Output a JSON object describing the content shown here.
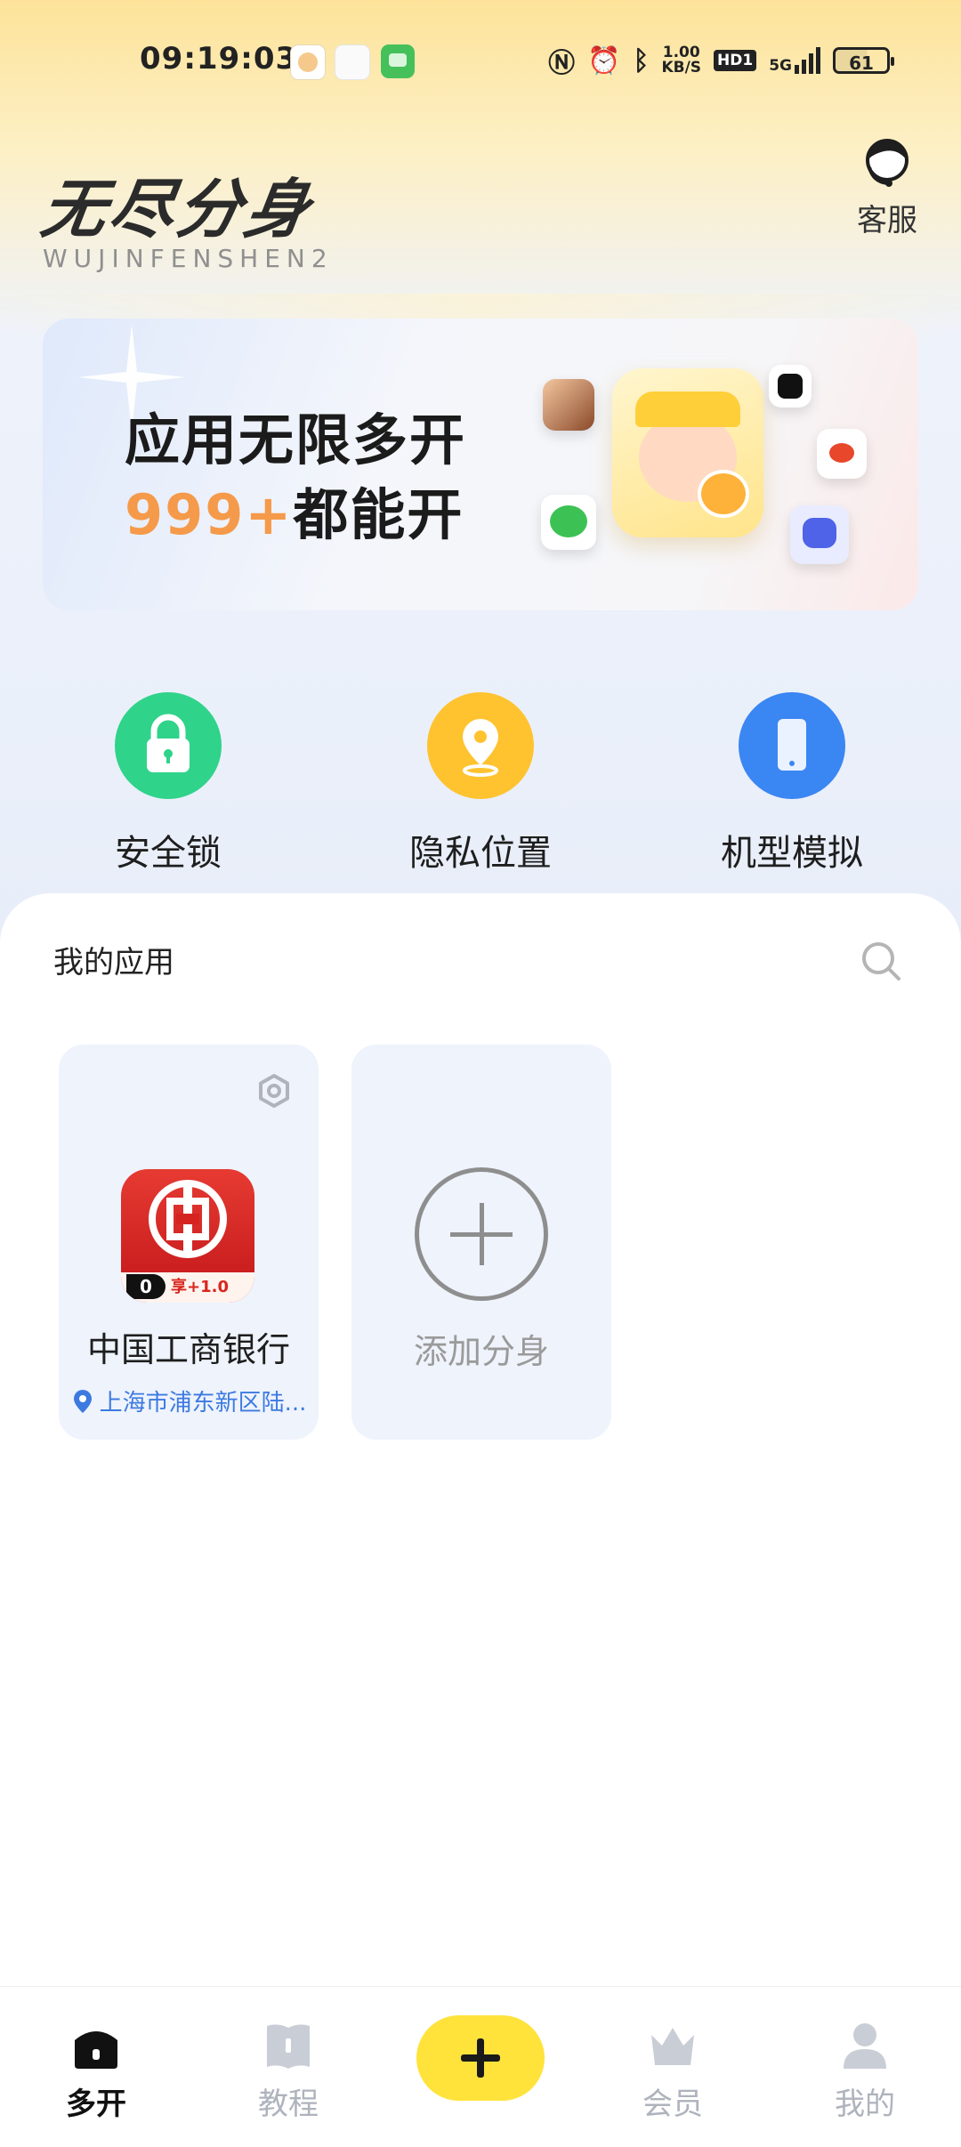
{
  "status_bar": {
    "time": "09:19:03",
    "net_speed_value": "1.00",
    "net_speed_unit": "KB/S",
    "hd_label": "HD1",
    "network_label": "5G",
    "battery": "61"
  },
  "header": {
    "title": "无尽分身",
    "subtitle": "WUJINFENSHEN2",
    "service_label": "客服"
  },
  "banner": {
    "line1": "应用无限多开",
    "line2_number": "999+",
    "line2_text": "都能开"
  },
  "features": [
    {
      "label": "安全锁",
      "icon": "lock-icon",
      "color": "#2fd38a"
    },
    {
      "label": "隐私位置",
      "icon": "location-pin-icon",
      "color": "#ffc330"
    },
    {
      "label": "机型模拟",
      "icon": "phone-icon",
      "color": "#3a86f3"
    }
  ],
  "my_apps": {
    "title": "我的应用",
    "apps": [
      {
        "name": "中国工商银行",
        "location": "上海市浦东新区陆...",
        "badge_count": "0",
        "badge_share": "享+1.0"
      }
    ],
    "add_label": "添加分身"
  },
  "bottom_nav": {
    "items": [
      {
        "label": "多开",
        "icon": "home-icon"
      },
      {
        "label": "教程",
        "icon": "book-icon"
      },
      {
        "label": "会员",
        "icon": "crown-icon"
      },
      {
        "label": "我的",
        "icon": "user-icon"
      }
    ],
    "active": "多开"
  },
  "colors": {
    "accent_yellow": "#ffe33b",
    "location_blue": "#3d7ae0",
    "banner_number_orange": "#f59a4a"
  }
}
